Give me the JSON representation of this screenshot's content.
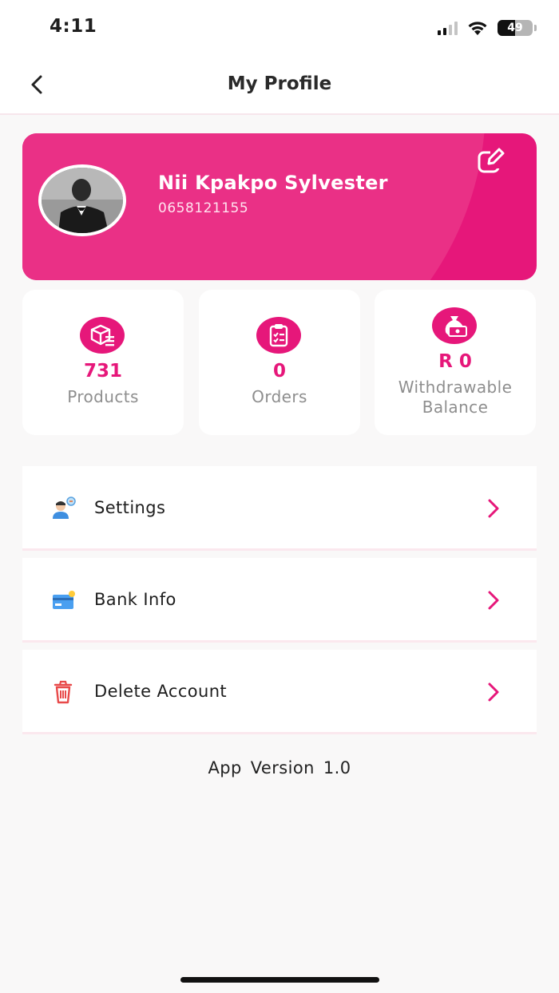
{
  "status_bar": {
    "time": "4:11",
    "battery_percent": "49",
    "signal_icon": "cellular-signal-icon",
    "wifi_icon": "wifi-icon"
  },
  "header": {
    "title": "My Profile",
    "back_icon": "chevron-left-icon"
  },
  "profile": {
    "name": "Nii Kpakpo Sylvester",
    "phone": "0658121155",
    "edit_icon": "edit-icon"
  },
  "stats": [
    {
      "value": "731",
      "label": "Products",
      "icon": "box-icon"
    },
    {
      "value": "0",
      "label": "Orders",
      "icon": "clipboard-icon"
    },
    {
      "value": "R 0",
      "label_line1": "Withdrawable",
      "label_line2": "Balance",
      "icon": "money-bag-icon"
    }
  ],
  "menu": [
    {
      "label": "Settings",
      "icon": "user-settings-icon"
    },
    {
      "label": "Bank Info",
      "icon": "credit-card-icon"
    },
    {
      "label": "Delete Account",
      "icon": "trash-icon"
    }
  ],
  "footer": {
    "app_version_label": "App Version",
    "app_version_value": "1.0"
  },
  "colors": {
    "accent": "#e6177a",
    "background": "#f9f8f8",
    "card": "#ffffff"
  }
}
